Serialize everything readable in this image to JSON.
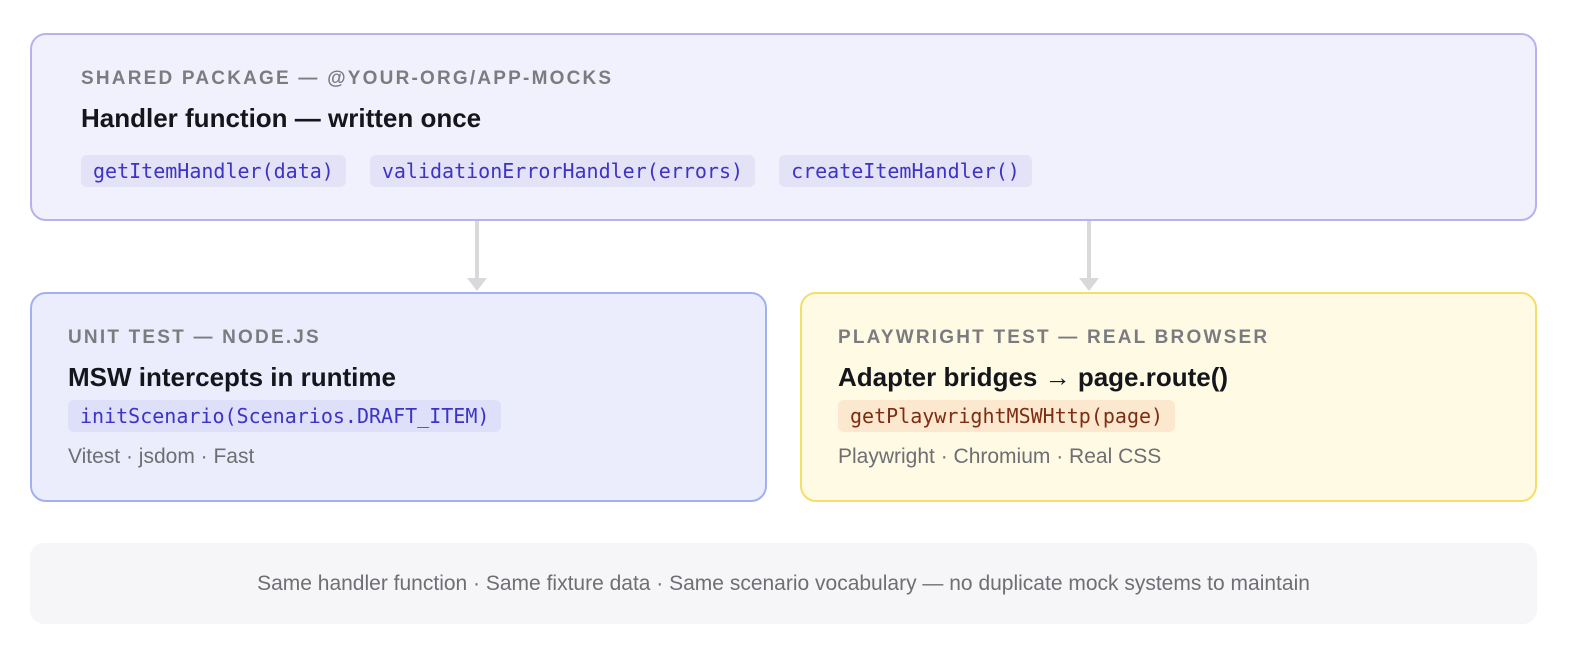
{
  "shared": {
    "eyebrow": "SHARED PACKAGE — @YOUR-ORG/APP-MOCKS",
    "title": "Handler function — written once",
    "chips": [
      "getItemHandler(data)",
      "validationErrorHandler(errors)",
      "createItemHandler()"
    ]
  },
  "unit": {
    "eyebrow": "UNIT TEST — NODE.JS",
    "title": "MSW intercepts in runtime",
    "code": "initScenario(Scenarios.DRAFT_ITEM)",
    "meta": "Vitest · jsdom · Fast"
  },
  "playwright": {
    "eyebrow": "PLAYWRIGHT TEST — REAL BROWSER",
    "title": "Adapter bridges → page.route()",
    "code": "getPlaywrightMSWHttp(page)",
    "meta": "Playwright · Chromium · Real CSS"
  },
  "footer": {
    "text": "Same handler function · Same fixture data · Same scenario vocabulary — no duplicate mock systems to maintain"
  },
  "colors": {
    "shared_bg": "#f1f0fd",
    "shared_border": "#b9b1ee",
    "unit_bg": "#ebedfc",
    "unit_border": "#a3b0ef",
    "playwright_bg": "#fefae3",
    "playwright_border": "#f5dd6a",
    "code_indigo": "#3d33c6",
    "code_amber": "#7c2d12"
  }
}
